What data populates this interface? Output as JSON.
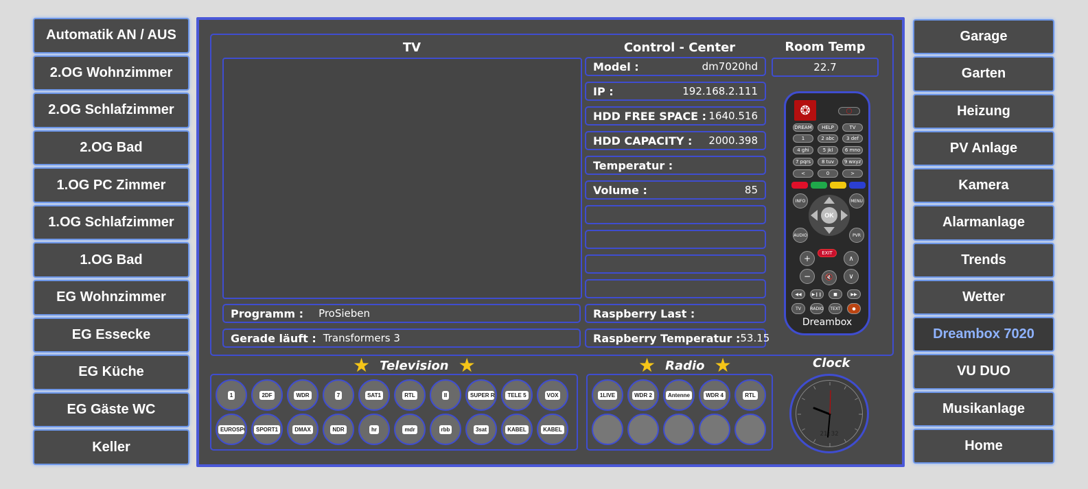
{
  "left_nav": [
    "Automatik AN / AUS",
    "2.OG Wohnzimmer",
    "2.OG Schlafzimmer",
    "2.OG Bad",
    "1.OG PC Zimmer",
    "1.OG Schlafzimmer",
    "1.OG Bad",
    "EG Wohnzimmer",
    "EG Essecke",
    "EG Küche",
    "EG Gäste WC",
    "Keller"
  ],
  "right_nav": [
    "Garage",
    "Garten",
    "Heizung",
    "PV Anlage",
    "Kamera",
    "Alarmanlage",
    "Trends",
    "Wetter",
    "Dreambox 7020",
    "VU DUO",
    "Musikanlage",
    "Home"
  ],
  "right_nav_active_index": 8,
  "headers": {
    "tv": "TV",
    "control": "Control - Center",
    "room_temp": "Room Temp",
    "television": "Television",
    "radio": "Radio",
    "clock": "Clock"
  },
  "room_temp_value": "22.7",
  "control": {
    "model_label": "Model :",
    "model_value": "dm7020hd",
    "ip_label": "IP :",
    "ip_value": "192.168.2.111",
    "hdd_free_label": "HDD FREE SPACE :",
    "hdd_free_value": "1640.516",
    "hdd_cap_label": "HDD CAPACITY :",
    "hdd_cap_value": "2000.398",
    "temp_label": "Temperatur :",
    "volume_label": "Volume :",
    "volume_value": "85",
    "rpi_load_label": "Raspberry Last :",
    "rpi_temp_label": "Raspberry Temperatur :",
    "rpi_temp_value": "53.15"
  },
  "program": {
    "program_label": "Programm :",
    "program_value": "ProSieben",
    "now_label": "Gerade läuft :",
    "now_value": "Transformers 3"
  },
  "remote": {
    "brand": "Dreambox",
    "ok": "OK",
    "exit": "EXIT",
    "row1": [
      "DREAM",
      "HELP",
      "TV"
    ],
    "digits": [
      "1",
      "2 abc",
      "3 def",
      "4 ghi",
      "5 jkl",
      "6 mno",
      "7 pqrs",
      "8 tuv",
      "9 wxyz",
      "<",
      "0",
      ">"
    ],
    "side_keys": [
      "INFO",
      "MENU",
      "AUDIO",
      "PVR"
    ],
    "bottom_keys": [
      "TV",
      "RADIO",
      "TEXT"
    ]
  },
  "tv_channels": [
    "1",
    "2DF",
    "WDR",
    "7",
    "SAT1",
    "RTL",
    "II",
    "SUPER RTL",
    "TELE 5",
    "VOX",
    "EUROSPORT",
    "SPORT1",
    "DMAX",
    "NDR",
    "hr",
    "mdr",
    "rbb",
    "3sat",
    "KABEL",
    "KABEL"
  ],
  "radio_channels": [
    "1LIVE",
    "WDR 2",
    "Antenne",
    "WDR 4",
    "RTL",
    "",
    "",
    "",
    "",
    ""
  ],
  "clock_digital": "21:32",
  "colors": {
    "accent_blue": "#3f4dd0",
    "nav_glow": "#6c95e6",
    "active_text": "#8fb3ff",
    "star": "#f5c518"
  }
}
